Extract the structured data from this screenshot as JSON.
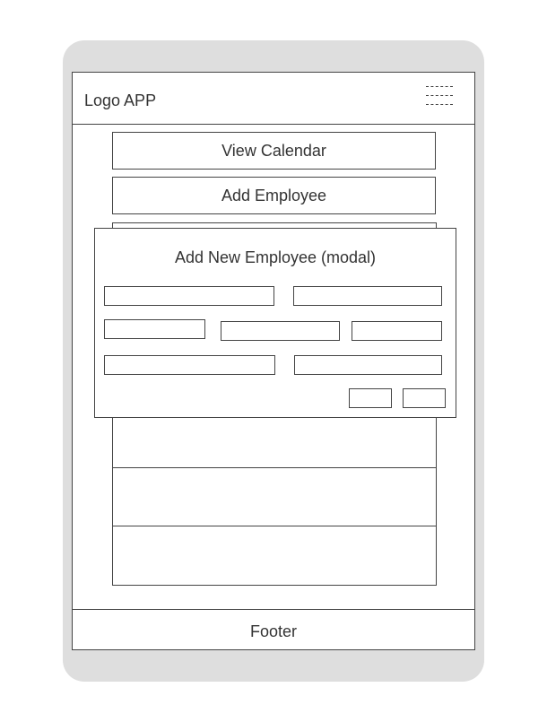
{
  "header": {
    "logo_text": "Logo APP",
    "menu_icon": "hamburger-menu-icon"
  },
  "main": {
    "view_calendar_label": "View Calendar",
    "add_employee_label": "Add Employee"
  },
  "modal": {
    "title": "Add New Employee (modal)"
  },
  "footer": {
    "text": "Footer"
  }
}
